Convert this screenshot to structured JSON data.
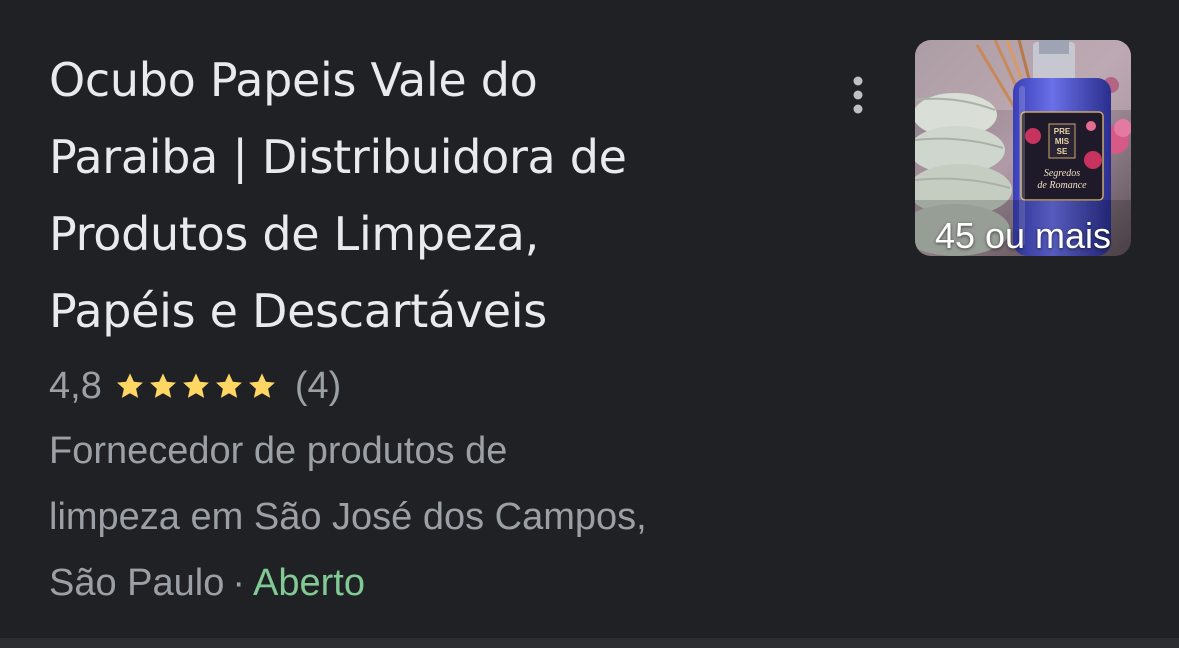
{
  "place": {
    "name_lines": [
      "Ocubo Papeis Vale do",
      "Paraiba | Distribuidora de",
      "Produtos de Limpeza,",
      "Papéis e Descartáveis"
    ],
    "rating": "4,8",
    "stars": 5,
    "review_count": "(4)",
    "category_lines": [
      "Fornecedor de produtos de",
      "limpeza em São José dos Campos,"
    ],
    "city": "São Paulo",
    "separator": "·",
    "status": "Aberto"
  },
  "photo": {
    "count_label": "45 ou mais",
    "product_label_lines": [
      "PRE",
      "MIS",
      "SE",
      "Segredos",
      "de Romance"
    ]
  },
  "menu": {
    "icon": "more-vert-icon"
  },
  "colors": {
    "background": "#202124",
    "title": "#e8eaed",
    "secondary": "#9aa0a6",
    "star": "#fdd663",
    "open": "#81c995"
  }
}
